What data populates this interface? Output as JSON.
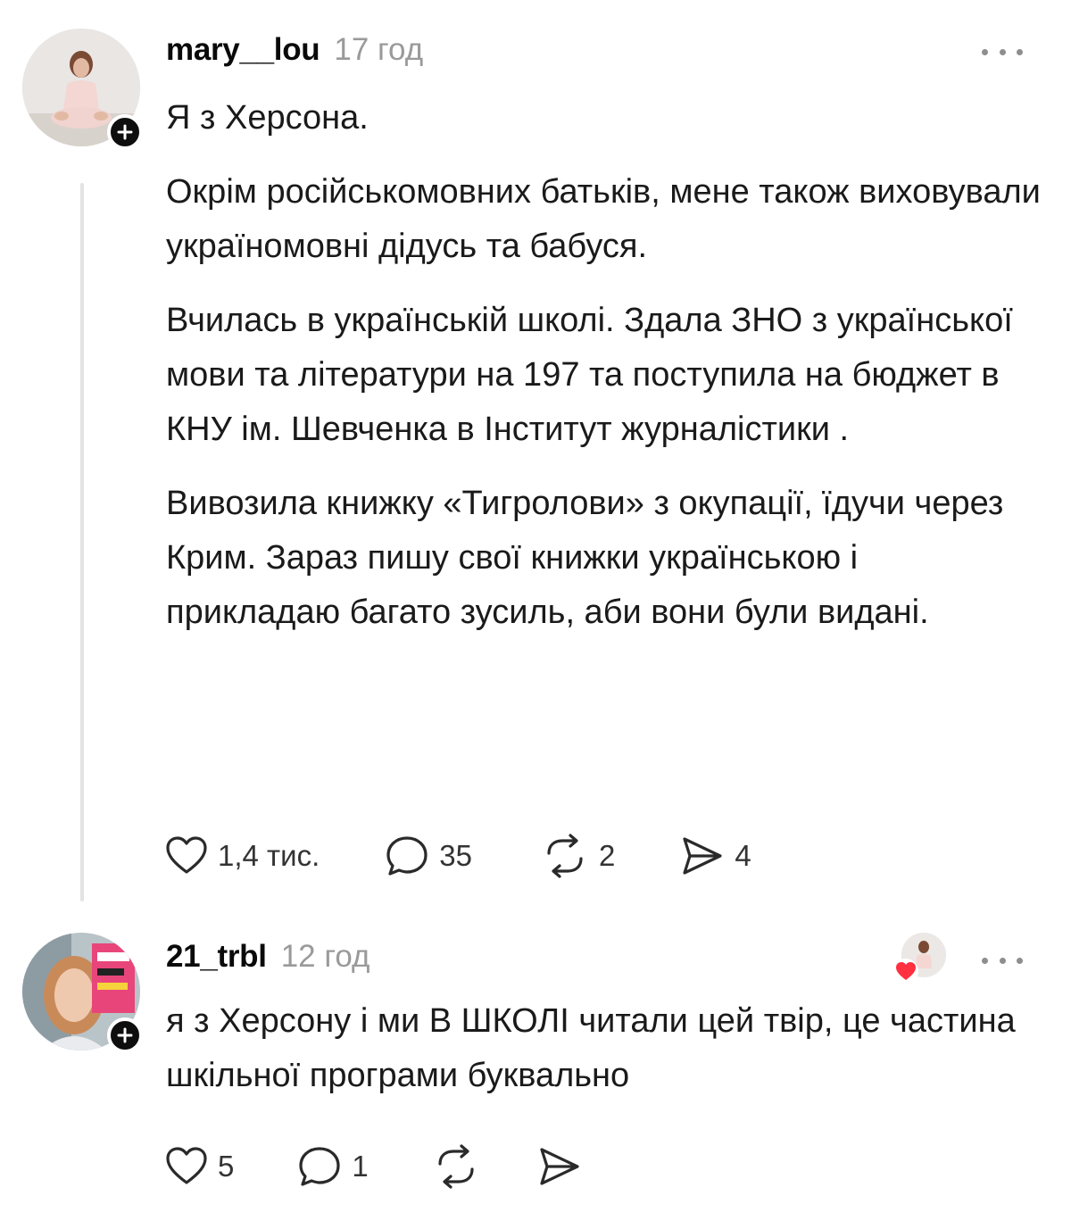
{
  "comments": [
    {
      "username": "mary__lou",
      "timestamp": "17 год",
      "paragraphs": [
        "Я з Херсона.",
        "Окрім російськомовних батьків, мене також виховували україномовні дідусь та бабуся.",
        "Вчилась в українській школі. Здала ЗНО з української мови та літератури на 197 та поступила на бюджет в КНУ ім. Шевченка в Інститут журналістики .",
        "Вивозила книжку «Тигролови» з окупації, їдучи через Крим. Зараз пишу свої книжки українською і прикладаю багато зусиль, аби вони були видані."
      ],
      "stats": {
        "likes": "1,4 тис.",
        "replies": "35",
        "reposts": "2",
        "shares": "4"
      }
    },
    {
      "username": "21_trbl",
      "timestamp": "12 год",
      "paragraphs": [
        "я з Херсону і ми В ШКОЛІ читали цей твір, це частина шкільної програми буквально"
      ],
      "stats": {
        "likes": "5",
        "replies": "1"
      },
      "liked_by_author": true
    }
  ],
  "icons": {
    "like": "heart-icon",
    "reply": "comment-bubble-icon",
    "repost": "repost-icon",
    "share": "share-send-icon",
    "more": "more-dots-icon",
    "follow": "plus-icon"
  },
  "colors": {
    "text": "#1a1a1a",
    "timestamp": "#9a9a9a",
    "follow_badge": "#0e0e0e",
    "liked_heart": "#ff3040"
  }
}
